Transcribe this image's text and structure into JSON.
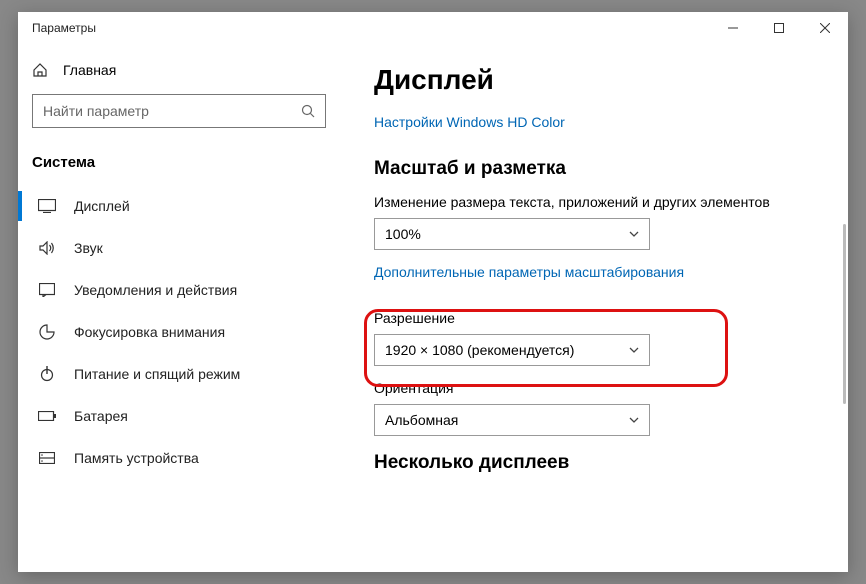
{
  "window": {
    "title": "Параметры"
  },
  "sidebar": {
    "home": "Главная",
    "search_placeholder": "Найти параметр",
    "section": "Система",
    "items": [
      {
        "label": "Дисплей"
      },
      {
        "label": "Звук"
      },
      {
        "label": "Уведомления и действия"
      },
      {
        "label": "Фокусировка внимания"
      },
      {
        "label": "Питание и спящий режим"
      },
      {
        "label": "Батарея"
      },
      {
        "label": "Память устройства"
      }
    ]
  },
  "main": {
    "title": "Дисплей",
    "hd_color_link": "Настройки Windows HD Color",
    "scale_heading": "Масштаб и разметка",
    "scale_label": "Изменение размера текста, приложений и других элементов",
    "scale_value": "100%",
    "adv_scale_link": "Дополнительные параметры масштабирования",
    "resolution_label": "Разрешение",
    "resolution_value": "1920 × 1080 (рекомендуется)",
    "orientation_label": "Ориентация",
    "orientation_value": "Альбомная",
    "multi_heading": "Несколько дисплеев"
  }
}
